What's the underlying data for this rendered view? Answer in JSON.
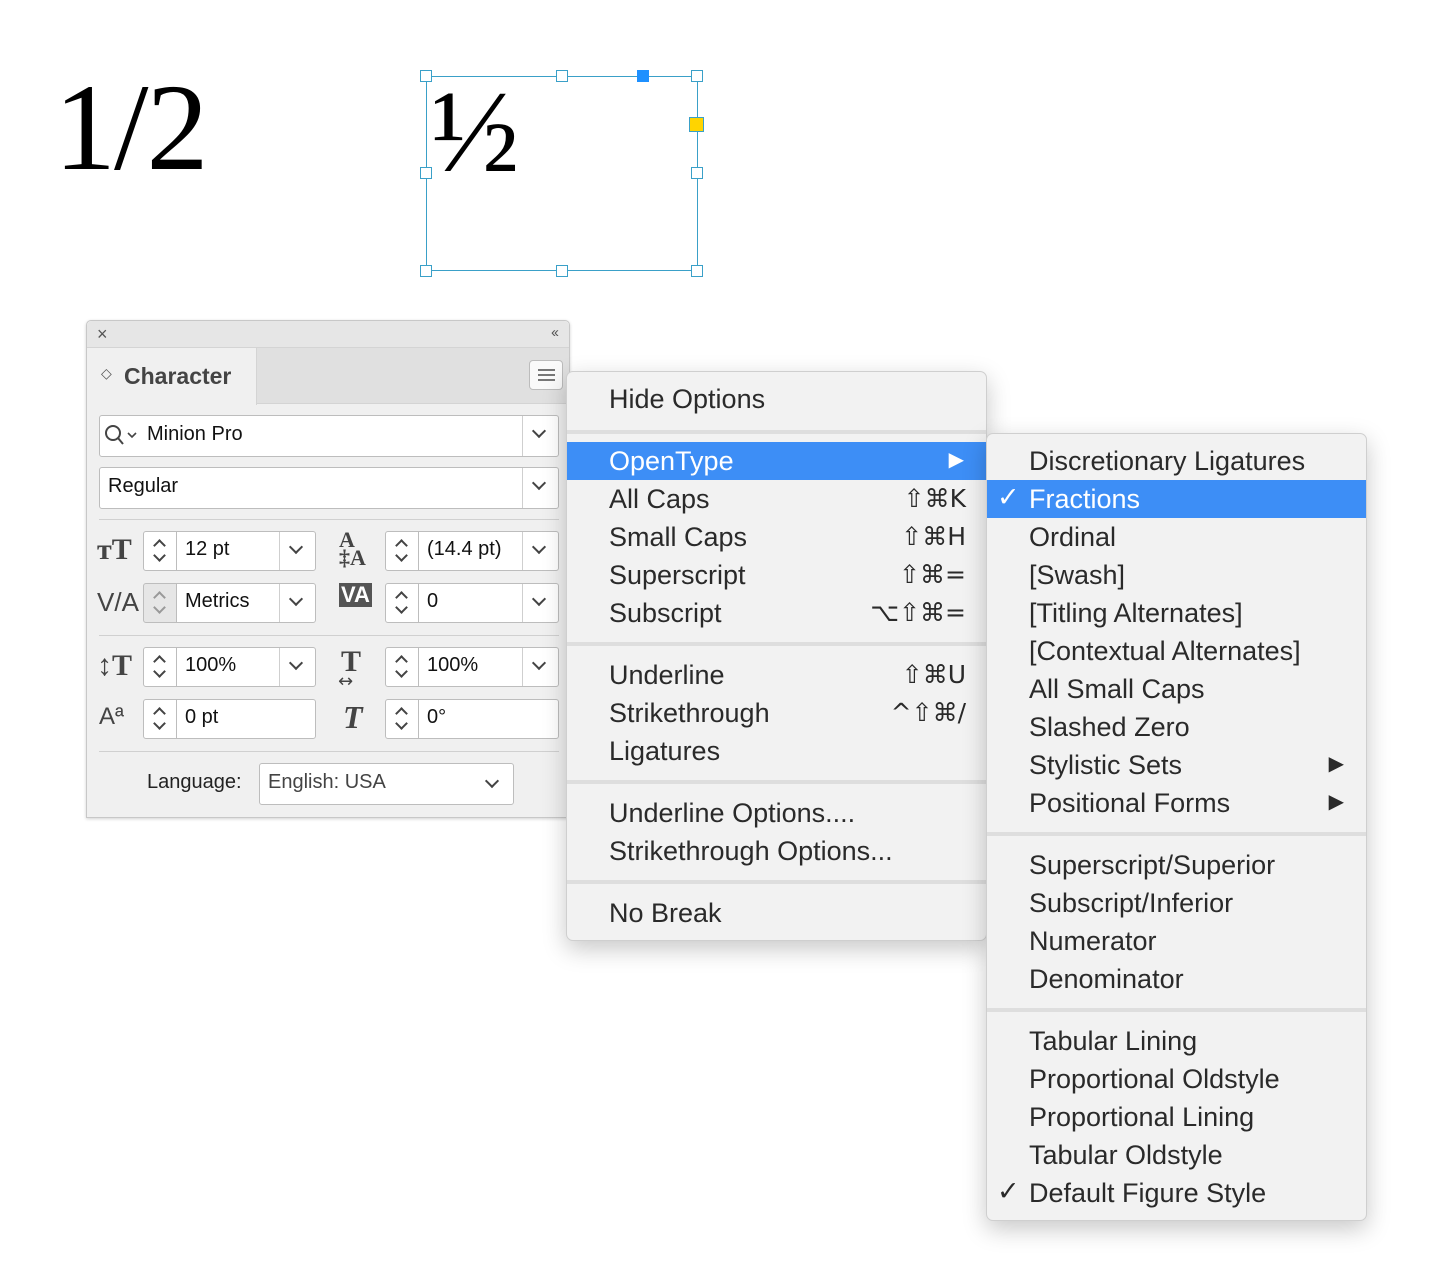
{
  "canvas": {
    "plain_text": "1/2",
    "fraction_glyph": "½"
  },
  "panel": {
    "title": "Character",
    "font_family": "Minion Pro",
    "font_style": "Regular",
    "font_size": "12 pt",
    "leading": "(14.4 pt)",
    "kerning": "Metrics",
    "tracking": "0",
    "vertical_scale": "100%",
    "horizontal_scale": "100%",
    "baseline_shift": "0 pt",
    "skew": "0°",
    "language_label": "Language:",
    "language_value": "English: USA"
  },
  "menu": {
    "items": [
      {
        "label": "Hide Options"
      },
      {
        "label": "OpenType"
      },
      {
        "label": "All Caps",
        "shortcut": "⇧⌘K"
      },
      {
        "label": "Small Caps",
        "shortcut": "⇧⌘H"
      },
      {
        "label": "Superscript",
        "shortcut": "⇧⌘="
      },
      {
        "label": "Subscript",
        "shortcut": "⌥⇧⌘="
      },
      {
        "label": "Underline",
        "shortcut": "⇧⌘U"
      },
      {
        "label": "Strikethrough",
        "shortcut": "^⇧⌘/"
      },
      {
        "label": "Ligatures"
      },
      {
        "label": "Underline Options...."
      },
      {
        "label": "Strikethrough Options..."
      },
      {
        "label": "No Break"
      }
    ]
  },
  "submenu": {
    "items": [
      {
        "label": "Discretionary Ligatures"
      },
      {
        "label": "Fractions",
        "checked": true
      },
      {
        "label": "Ordinal"
      },
      {
        "label": "[Swash]"
      },
      {
        "label": "[Titling Alternates]"
      },
      {
        "label": "[Contextual Alternates]"
      },
      {
        "label": "All Small Caps"
      },
      {
        "label": "Slashed Zero"
      },
      {
        "label": "Stylistic Sets"
      },
      {
        "label": "Positional Forms"
      },
      {
        "label": "Superscript/Superior"
      },
      {
        "label": "Subscript/Inferior"
      },
      {
        "label": "Numerator"
      },
      {
        "label": "Denominator"
      },
      {
        "label": "Tabular Lining"
      },
      {
        "label": "Proportional Oldstyle"
      },
      {
        "label": "Proportional Lining"
      },
      {
        "label": "Tabular Oldstyle"
      },
      {
        "label": "Default Figure Style",
        "checked": true
      }
    ]
  },
  "glyphs": {
    "check": "✓",
    "submenu_arrow": "▶",
    "close": "×",
    "collapse": "‹‹",
    "tab_arrows": "◇"
  },
  "colors": {
    "highlight": "#3d8ef6",
    "frame": "#3aa0c8",
    "handle_filled": "#1e90ff",
    "handle_yellow": "#ffd400"
  }
}
